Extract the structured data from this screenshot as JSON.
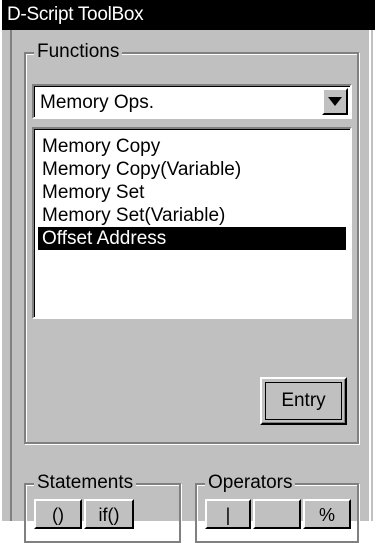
{
  "window": {
    "title": "D-Script ToolBox"
  },
  "functions": {
    "legend": "Functions",
    "select_value": "Memory Ops.",
    "items": [
      {
        "label": "Memory Copy",
        "selected": false
      },
      {
        "label": "Memory Copy(Variable)",
        "selected": false
      },
      {
        "label": "Memory Set",
        "selected": false
      },
      {
        "label": "Memory Set(Variable)",
        "selected": false
      },
      {
        "label": "Offset Address",
        "selected": true
      }
    ],
    "entry_label": "Entry"
  },
  "statements": {
    "legend": "Statements",
    "buttons": [
      "()",
      "if()"
    ]
  },
  "operators": {
    "legend": "Operators",
    "buttons": [
      "|",
      "",
      "%"
    ]
  },
  "colors": {
    "face": "#c0c0c0",
    "selection": "#000000",
    "title_bar": "#000000"
  }
}
